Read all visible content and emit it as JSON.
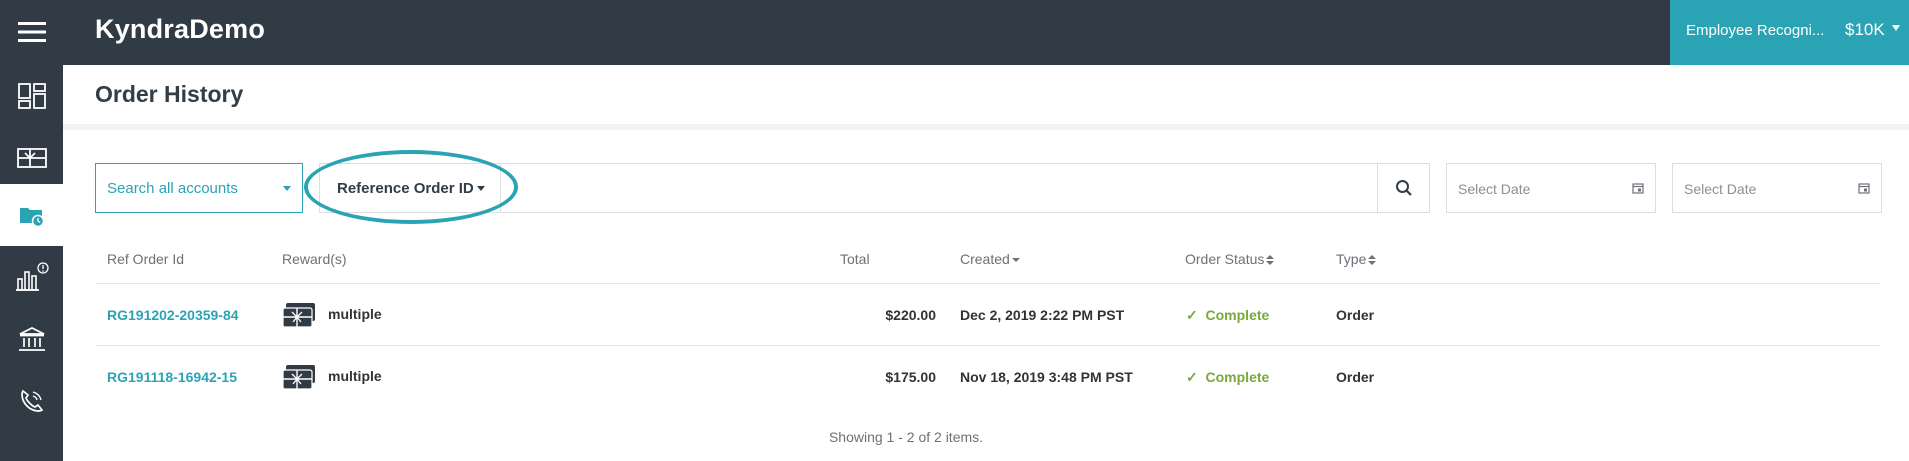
{
  "app": {
    "brand": "KyndraDemo",
    "account_name": "Employee Recogni...",
    "balance": "$10K",
    "accent_color": "#2aa4b5",
    "rail_color": "#313b45"
  },
  "sidebar": {
    "items": [
      {
        "icon": "dashboard-icon"
      },
      {
        "icon": "gift-card-icon"
      },
      {
        "icon": "order-history-icon",
        "active": true
      },
      {
        "icon": "reports-icon",
        "badge": "!"
      },
      {
        "icon": "bank-icon"
      },
      {
        "icon": "support-phone-icon"
      }
    ]
  },
  "page": {
    "title": "Order History"
  },
  "filters": {
    "account_select": "Search all accounts",
    "field_select": "Reference Order ID",
    "search_value": "",
    "start_date_placeholder": "Select Date",
    "end_date_placeholder": "Select Date"
  },
  "table": {
    "headers": {
      "ref": "Ref Order Id",
      "reward": "Reward(s)",
      "total": "Total",
      "created": "Created",
      "status": "Order Status",
      "type": "Type"
    },
    "rows": [
      {
        "ref": "RG191202-20359-84",
        "reward": "multiple",
        "total": "$220.00",
        "created": "Dec 2, 2019 2:22 PM PST",
        "status": "Complete",
        "type": "Order"
      },
      {
        "ref": "RG191118-16942-15",
        "reward": "multiple",
        "total": "$175.00",
        "created": "Nov 18, 2019 3:48 PM PST",
        "status": "Complete",
        "type": "Order"
      }
    ],
    "status_mark": "✓",
    "footer": "Showing 1 - 2 of 2 items."
  }
}
